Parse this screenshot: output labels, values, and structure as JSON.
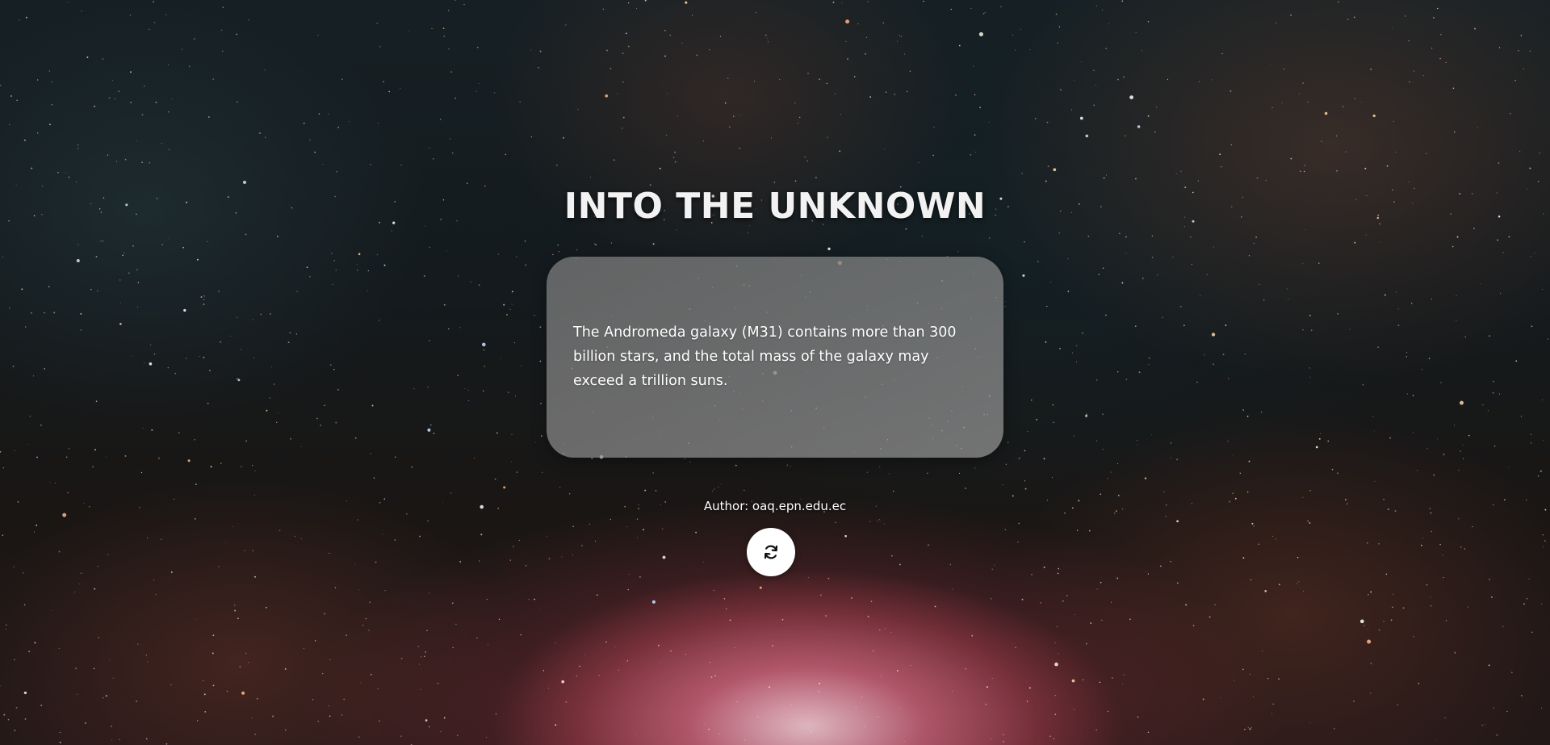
{
  "page": {
    "title": "INTO THE UNKNOWN"
  },
  "fact": {
    "text": "The Andromeda galaxy (M31) contains more than 300 billion stars, and the total mass of the galaxy may exceed a trillion suns."
  },
  "author": {
    "label": "Author: oaq.epn.edu.ec"
  },
  "controls": {
    "refresh_icon": "refresh-icon"
  },
  "colors": {
    "card_background": "#8a8a8a",
    "button_background": "#ffffff",
    "text": "#ffffff"
  }
}
